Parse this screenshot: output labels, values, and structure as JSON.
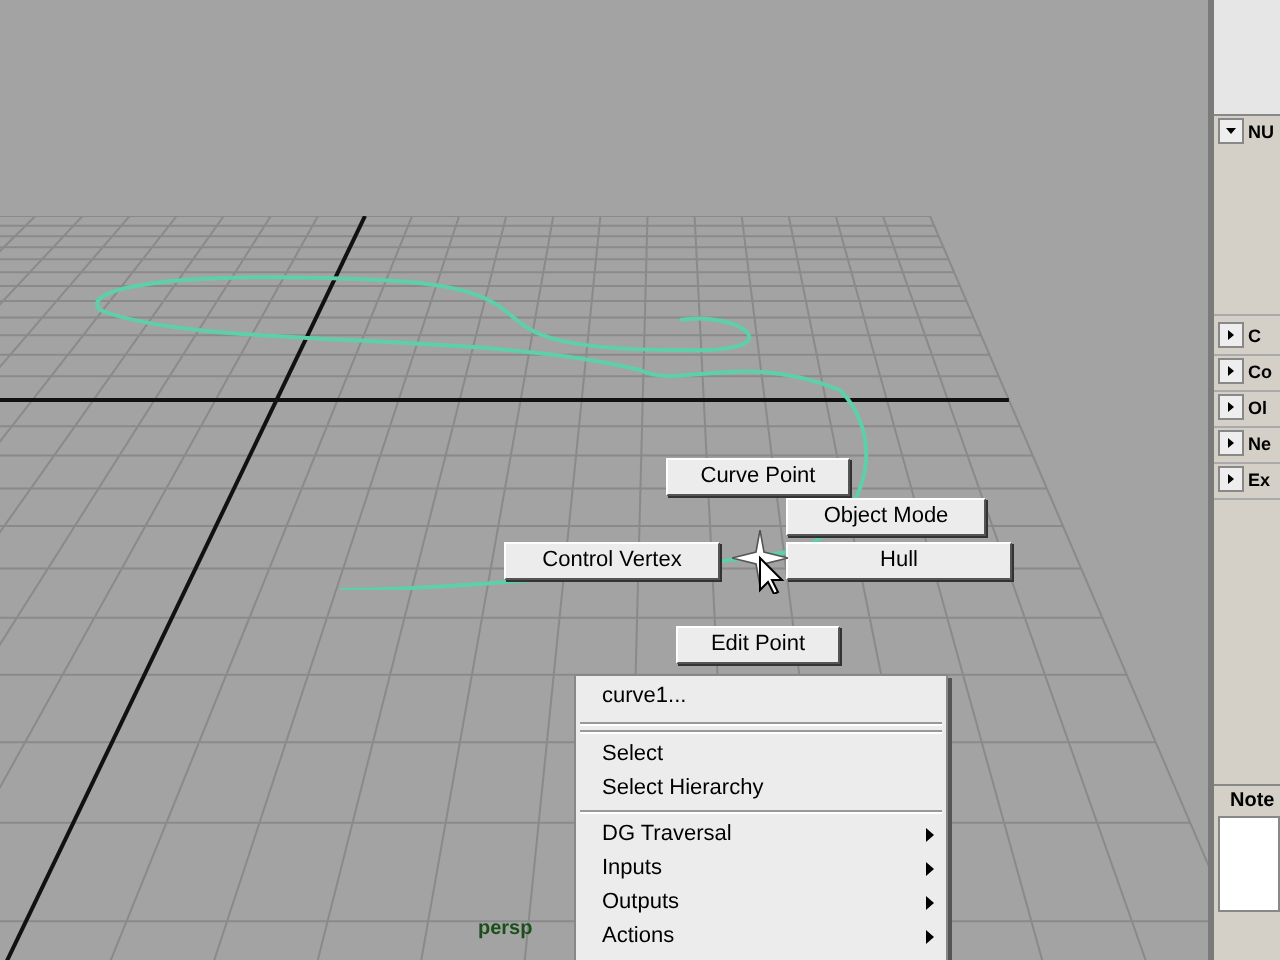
{
  "viewport": {
    "camera_label": "persp"
  },
  "marking_menu": [
    {
      "label": "Curve Point"
    },
    {
      "label": "Object Mode"
    },
    {
      "label": "Control Vertex"
    },
    {
      "label": "Hull"
    },
    {
      "label": "Edit Point"
    }
  ],
  "context_menu": [
    {
      "kind": "title",
      "label": "curve1..."
    },
    {
      "kind": "separator"
    },
    {
      "kind": "separator"
    },
    {
      "kind": "item",
      "label": "Select"
    },
    {
      "kind": "item",
      "label": "Select Hierarchy"
    },
    {
      "kind": "separator"
    },
    {
      "kind": "submenu",
      "label": "DG Traversal"
    },
    {
      "kind": "submenu",
      "label": "Inputs"
    },
    {
      "kind": "submenu",
      "label": "Outputs"
    },
    {
      "kind": "submenu",
      "label": "Actions"
    }
  ],
  "side_panel": {
    "sections": [
      {
        "label": "NU",
        "expanded": true
      },
      {
        "label": "C",
        "expanded": false
      },
      {
        "label": "Co",
        "expanded": false
      },
      {
        "label": "Ol",
        "expanded": false
      },
      {
        "label": "Ne",
        "expanded": false
      },
      {
        "label": "Ex",
        "expanded": false
      }
    ],
    "notes_label": "Note"
  }
}
